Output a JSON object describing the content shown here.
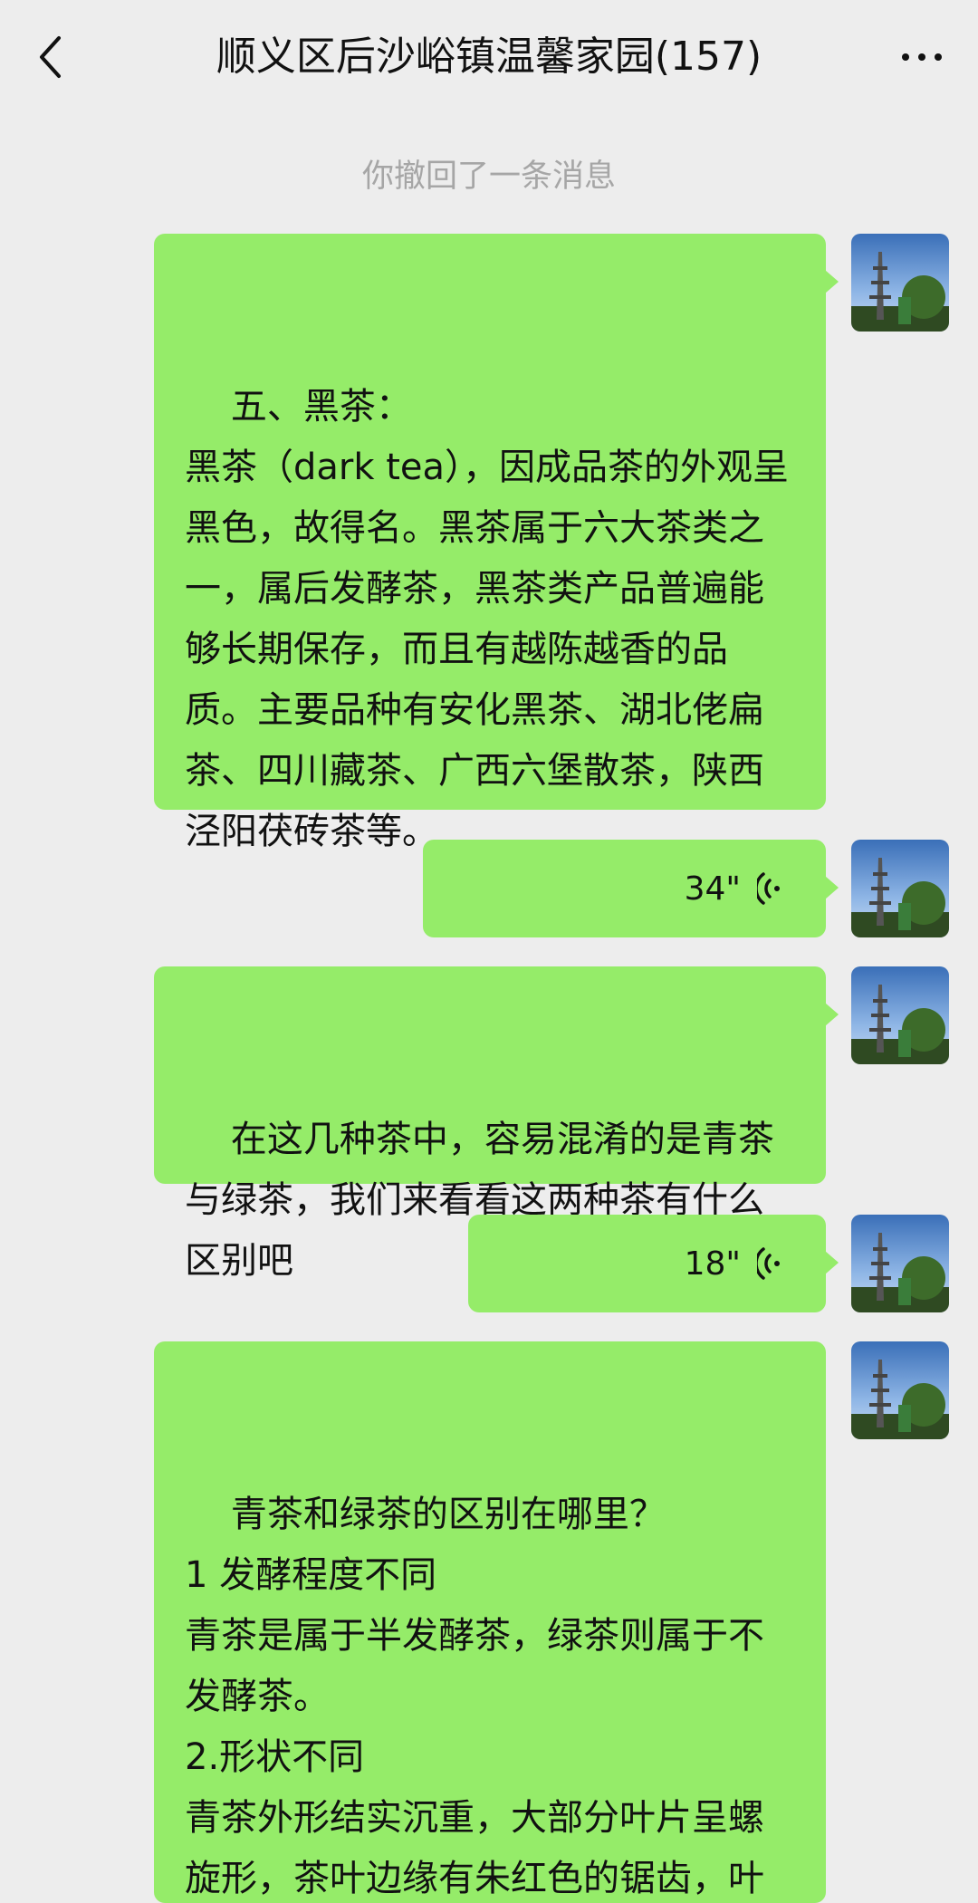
{
  "header": {
    "title": "顺义区后沙峪镇温馨家园(157)"
  },
  "system_message": "你撤回了一条消息",
  "messages": [
    {
      "type": "text",
      "text": "五、黑茶：\n黑茶（dark tea），因成品茶的外观呈黑色，故得名。黑茶属于六大茶类之一，属后发酵茶，黑茶类产品普遍能够长期保存，而且有越陈越香的品质。主要品种有安化黑茶、湖北佬扁茶、四川藏茶、广西六堡散茶，陕西泾阳茯砖茶等。"
    },
    {
      "type": "voice",
      "duration": "34\""
    },
    {
      "type": "text",
      "text": "在这几种茶中，容易混淆的是青茶与绿茶，我们来看看这两种茶有什么区别吧"
    },
    {
      "type": "voice",
      "duration": "18\""
    },
    {
      "type": "text",
      "text": "青茶和绿茶的区别在哪里？\n1 发酵程度不同\n青茶是属于半发酵茶，绿茶则属于不发酵茶。\n2.形状不同\n青茶外形结实沉重，大部分叶片呈螺旋形，茶叶边缘有朱红色的锯齿，叶片呈墨绿色"
    }
  ],
  "colors": {
    "background": "#ededed",
    "bubble": "#95ec69",
    "system_text": "#a6a6a6"
  },
  "icons": [
    "back-arrow-icon",
    "more-dots-icon",
    "voice-wave-icon",
    "user-avatar"
  ]
}
